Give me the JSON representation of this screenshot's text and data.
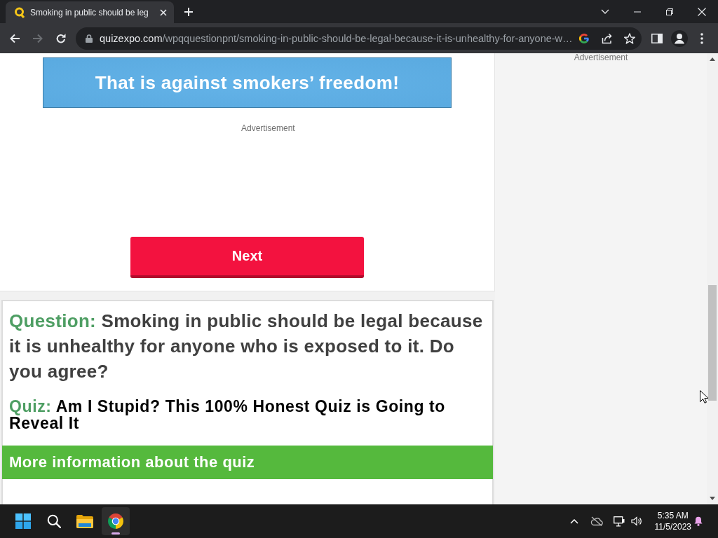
{
  "browser": {
    "tabs": [
      {
        "title": "Smoking in public should be leg",
        "selected": true
      }
    ],
    "forward": {
      "disabled": true
    },
    "address": {
      "host": "quizexpo.com",
      "path": "/wpqquestionpnt/smoking-in-public-should-be-legal-because-it-is-unhealthy-for-anyone-w…"
    }
  },
  "main": {
    "answer": "That is against smokers’ freedom!",
    "ad_label": "Advertisement",
    "next_button": "Next"
  },
  "question_card": {
    "question_label": "Question:",
    "question": "Smoking in public should be legal because it is unhealthy for anyone who is exposed to it. Do you agree?",
    "quiz_label": "Quiz:",
    "quiz": "Am I Stupid? This 100% Honest Quiz is Going to Reveal It",
    "info_bar": "More information about the quiz"
  },
  "sidebar": {
    "ad_label": "Advertisement"
  },
  "taskbar": {
    "apps": [
      {
        "selected": false
      },
      {
        "selected": false
      },
      {
        "selected": false
      },
      {
        "selected": true
      }
    ],
    "time": "5:35 AM",
    "date": "11/5/2023"
  }
}
